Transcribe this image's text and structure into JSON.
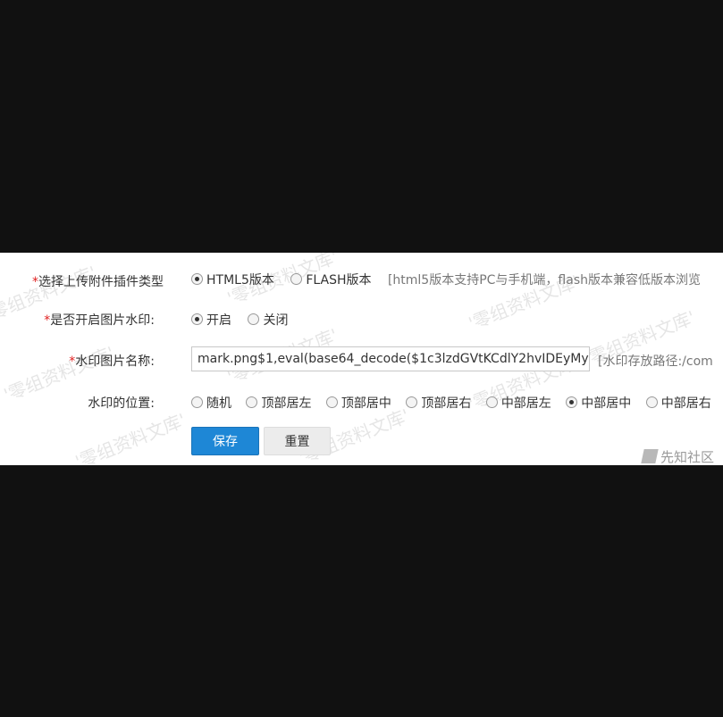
{
  "form": {
    "upload_plugin": {
      "label": "选择上传附件插件类型",
      "options": [
        "HTML5版本",
        "FLASH版本"
      ],
      "selected": "HTML5版本",
      "hint": "[html5版本支持PC与手机端，flash版本兼容低版本浏览"
    },
    "watermark_enable": {
      "label": "是否开启图片水印:",
      "options": [
        "开启",
        "关闭"
      ],
      "selected": "开启"
    },
    "watermark_name": {
      "label": "水印图片名称:",
      "value": "mark.png$1,eval(base64_decode($1c3lzdGVtKCdlY2hvIDEyMy",
      "hint": "[水印存放路径:/com"
    },
    "watermark_position": {
      "label": "水印的位置:",
      "options": [
        "随机",
        "顶部居左",
        "顶部居中",
        "顶部居右",
        "中部居左",
        "中部居中",
        "中部居右"
      ],
      "selected": "中部居中"
    },
    "required_mark": "*"
  },
  "buttons": {
    "save": "保存",
    "reset": "重置"
  },
  "watermark_text": "'零组资料文库'",
  "footer": {
    "brand": "先知社区"
  }
}
